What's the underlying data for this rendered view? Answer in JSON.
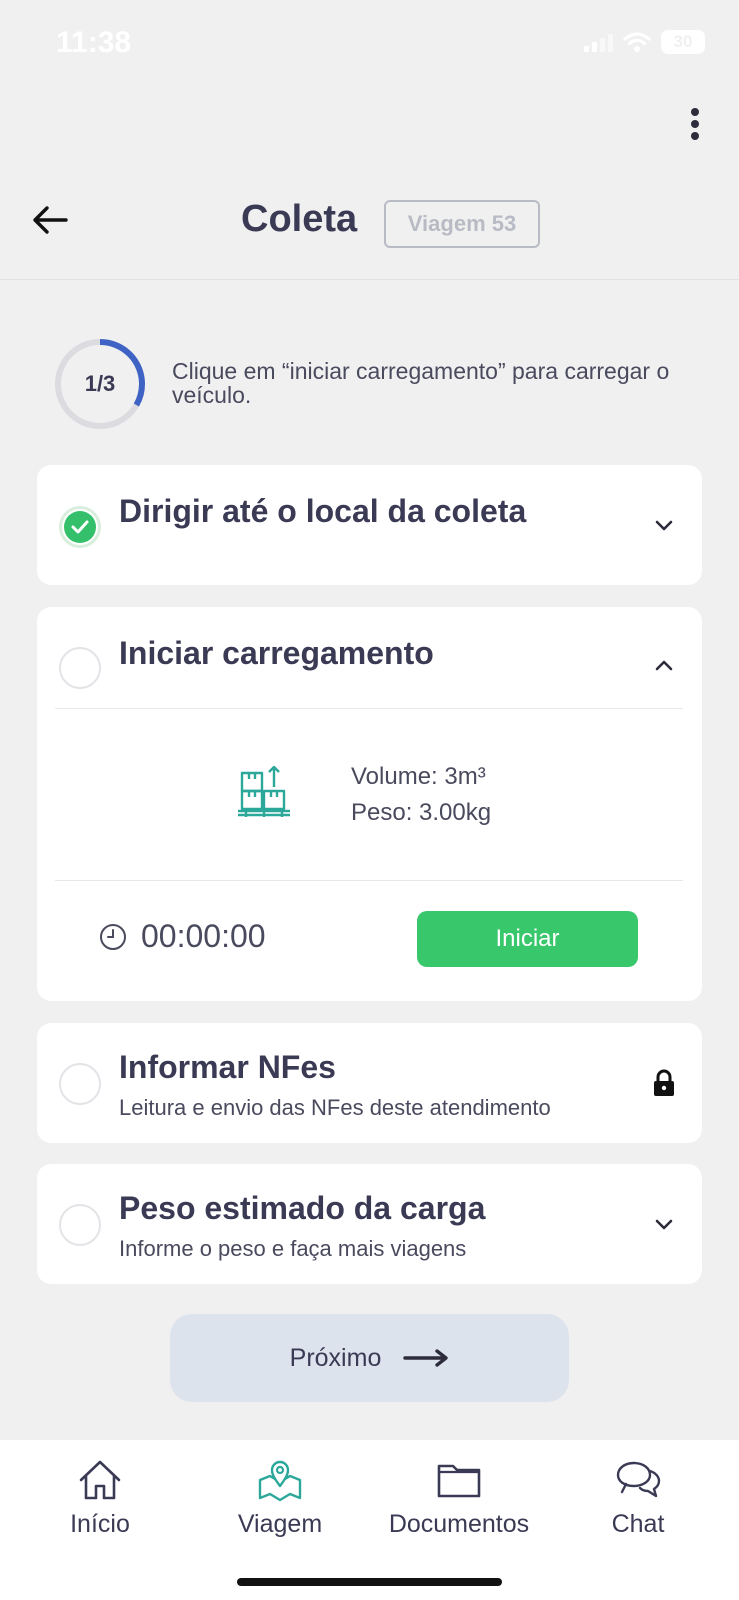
{
  "status_bar": {
    "time": "11:38",
    "battery": "30"
  },
  "header": {
    "title": "Coleta",
    "trip_badge": "Viagem 53"
  },
  "progress": {
    "label": "1/3",
    "fraction": 0.333,
    "instruction": "Clique em “iniciar carregamento” para carregar o veículo."
  },
  "steps": [
    {
      "title": "Dirigir até o local da coleta",
      "completed": true,
      "state": "collapsed"
    },
    {
      "title": "Iniciar carregamento",
      "completed": false,
      "state": "expanded",
      "volume": "Volume: 3m³",
      "weight": "Peso: 3.00kg",
      "timer": "00:00:00",
      "start_label": "Iniciar"
    },
    {
      "title": "Informar NFes",
      "subtitle": "Leitura e envio das NFes deste atendimento",
      "completed": false,
      "state": "locked"
    },
    {
      "title": "Peso estimado da carga",
      "subtitle": "Informe o peso e faça mais viagens",
      "completed": false,
      "state": "collapsed"
    }
  ],
  "next_button": {
    "label": "Próximo"
  },
  "bottom_nav": [
    {
      "label": "Início",
      "icon": "home-icon",
      "active": false
    },
    {
      "label": "Viagem",
      "icon": "map-pin-icon",
      "active": true
    },
    {
      "label": "Documentos",
      "icon": "folder-icon",
      "active": false
    },
    {
      "label": "Chat",
      "icon": "chat-icon",
      "active": false
    }
  ],
  "colors": {
    "accent_green": "#38c76b",
    "progress_blue": "#3f63c4",
    "teal_icon": "#2ba89a",
    "text_dark": "#3a3a55"
  }
}
